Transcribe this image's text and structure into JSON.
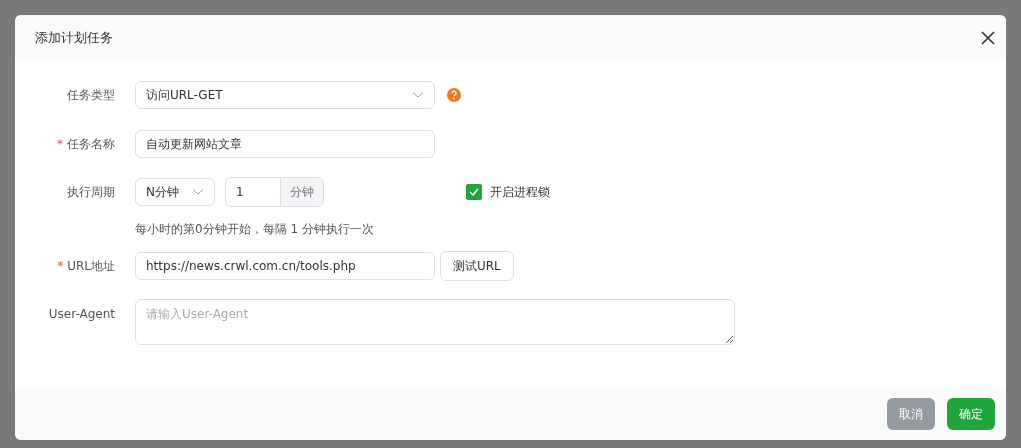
{
  "dialog": {
    "title": "添加计划任务"
  },
  "required_mark": "*",
  "form": {
    "task_type": {
      "label": "任务类型",
      "required": false,
      "value": "访问URL-GET"
    },
    "task_name": {
      "label": "任务名称",
      "required": true,
      "value": "自动更新网站文章"
    },
    "period": {
      "label": "执行周期",
      "required": false,
      "unit_select": "N分钟",
      "interval": "1",
      "interval_suffix": "分钟",
      "lock": {
        "label": "开启进程锁",
        "checked": true
      },
      "hint": "每小时的第0分钟开始，每隔 1 分钟执行一次"
    },
    "url": {
      "label": "URL地址",
      "required": true,
      "value": "https://news.crwl.com.cn/tools.php",
      "test_button": "测试URL"
    },
    "user_agent": {
      "label": "User-Agent",
      "required": false,
      "placeholder": "请输入User-Agent"
    }
  },
  "buttons": {
    "cancel": "取消",
    "confirm": "确定"
  }
}
